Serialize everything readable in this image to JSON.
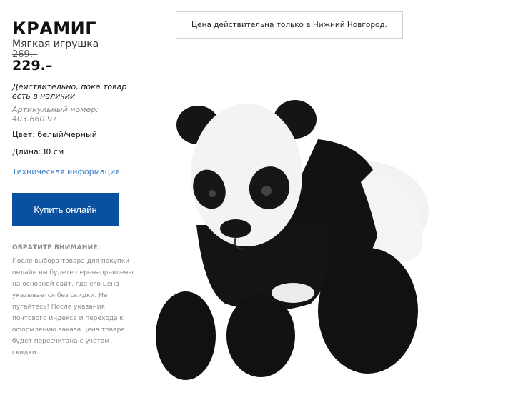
{
  "product": {
    "name": "КРАМИГ",
    "type": "Мягкая игрушка",
    "old_price": "269.–",
    "price": "229.–",
    "availability": "Действительно, пока товар есть в наличии",
    "article": "Артикульный номер: 403.660.97",
    "color": "Цвет: белый/черный",
    "length": "Длина:30 см",
    "tech_info_link": "Техническая информация:"
  },
  "actions": {
    "buy_label": "Купить онлайн"
  },
  "notice": {
    "city_price": "Цена действительна только в Нижний Новгород."
  },
  "attention": {
    "heading": "ОБРАТИТЕ ВНИМАНИЕ:",
    "body": "После выбора товара для покупки онлайн вы будете перенаправлены на основной сайт, где его цена указывается без скидки. Не пугайтесь! После указания почтового индекса и перехода к оформлению заказа цена товара будет пересчитана с учетом скидки."
  },
  "colors": {
    "button": "#0a50a1",
    "link": "#3a7dc9"
  }
}
